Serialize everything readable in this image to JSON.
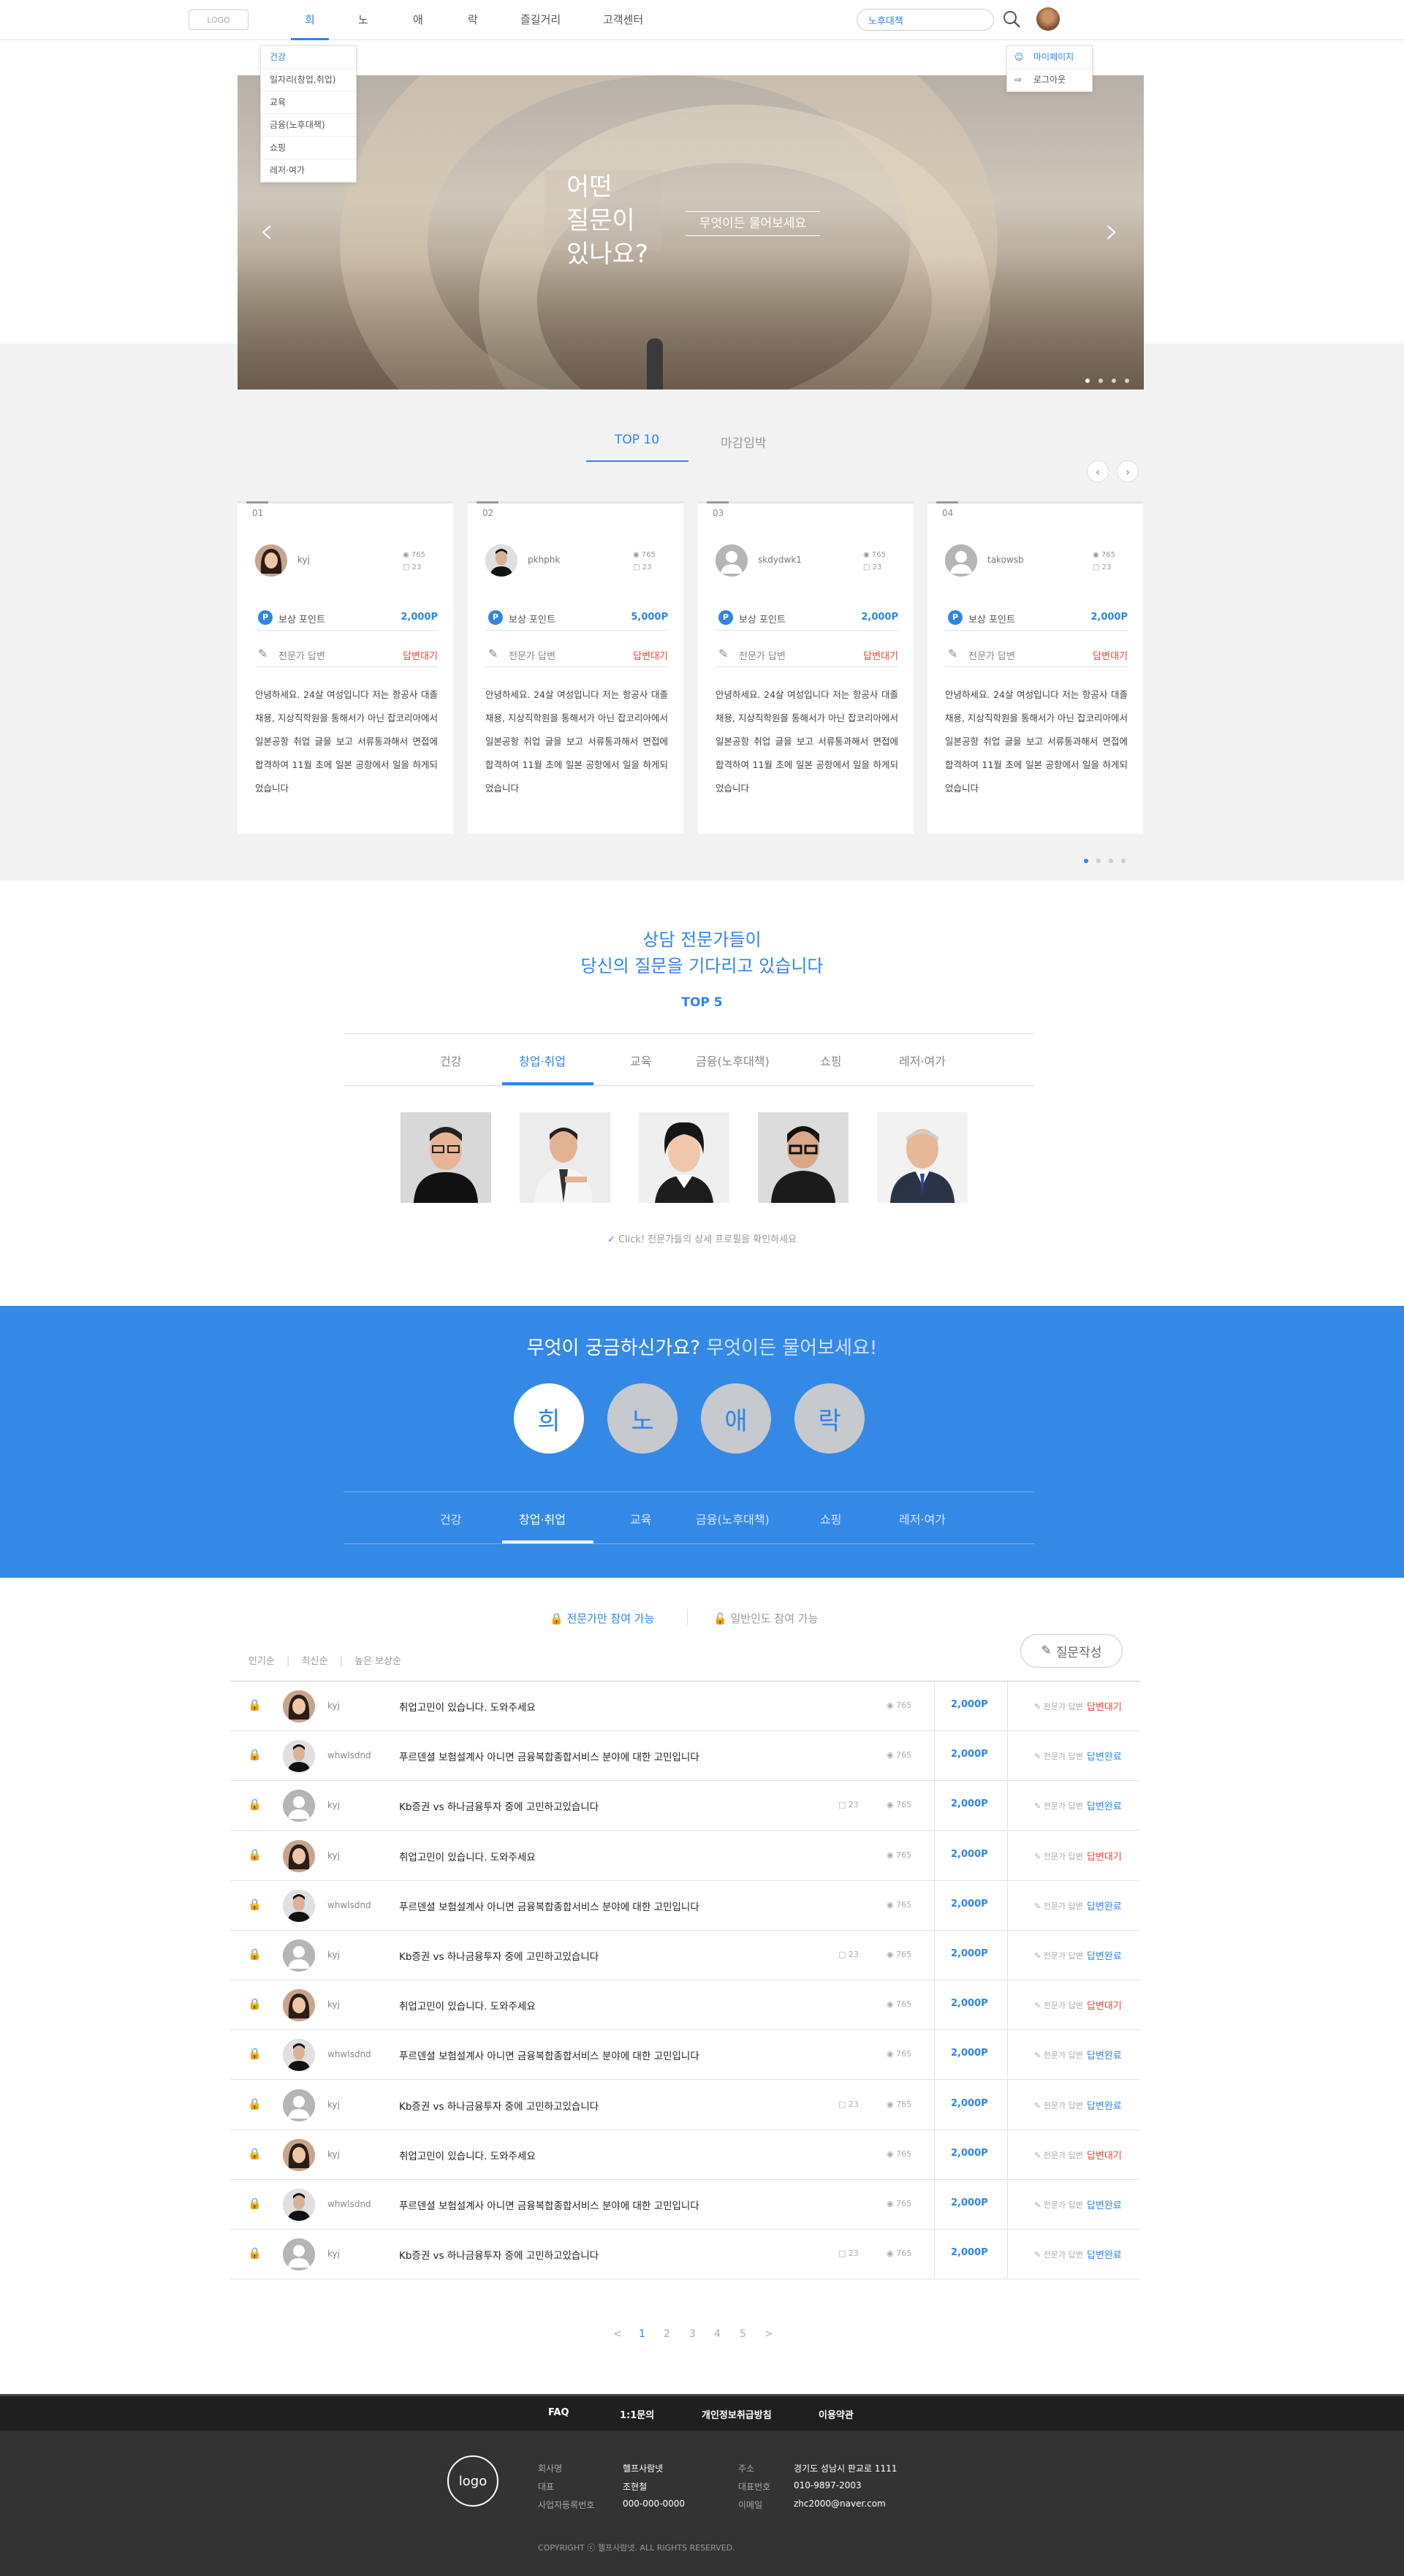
{
  "header": {
    "logo": "LOGO",
    "nav": [
      "희",
      "노",
      "애",
      "락",
      "즐길거리",
      "고객센터"
    ],
    "search_value": "노후대책"
  },
  "category_dropdown": [
    "건강",
    "일자리(창업,취업)",
    "교육",
    "금융(노후대책)",
    "쇼핑",
    "레저·여가"
  ],
  "user_menu": [
    "마이페이지",
    "로그아웃"
  ],
  "hero": {
    "title": "어떤\n질문이\n있나요?",
    "ask": "무엇이든 물어보세요"
  },
  "top_tabs": [
    "TOP 10",
    "마감임박"
  ],
  "cards": [
    {
      "num": "01",
      "name": "kyj",
      "views": "765",
      "comments": "23",
      "point_label": "보상 포인트",
      "point": "2,000P",
      "answer_label": "전문가 답변",
      "status": "답변대기",
      "body": "안녕하세요. 24살 여성입니다 저는 항공사 대졸채용, 지상직학원을 통해서가 아닌 잡코리아에서 일본공항 취업 글을 보고 서류통과해서 면접에 합격하여 11월 초에 일본 공항에서 일을 하게되었습니다"
    },
    {
      "num": "02",
      "name": "pkhphk",
      "views": "765",
      "comments": "23",
      "point_label": "보상 포인트",
      "point": "5,000P",
      "answer_label": "전문가 답변",
      "status": "답변대기",
      "body": "안녕하세요. 24살 여성입니다 저는 항공사 대졸채용, 지상직학원을 통해서가 아닌 잡코리아에서 일본공항 취업 글을 보고 서류통과해서 면접에 합격하여 11월 초에 일본 공항에서 일을 하게되었습니다"
    },
    {
      "num": "03",
      "name": "skdydwk1",
      "views": "765",
      "comments": "23",
      "point_label": "보상 포인트",
      "point": "2,000P",
      "answer_label": "전문가 답변",
      "status": "답변대기",
      "body": "안녕하세요. 24살 여성입니다 저는 항공사 대졸채용, 지상직학원을 통해서가 아닌 잡코리아에서 일본공항 취업 글을 보고 서류통과해서 면접에 합격하여 11월 초에 일본 공항에서 일을 하게되었습니다"
    },
    {
      "num": "04",
      "name": "takowsb",
      "views": "765",
      "comments": "23",
      "point_label": "보상 포인트",
      "point": "2,000P",
      "answer_label": "전문가 답변",
      "status": "답변대기",
      "body": "안녕하세요. 24살 여성입니다 저는 항공사 대졸채용, 지상직학원을 통해서가 아닌 잡코리아에서 일본공항 취업 글을 보고 서류통과해서 면접에 합격하여 11월 초에 일본 공항에서 일을 하게되었습니다"
    }
  ],
  "experts": {
    "line1": "상담 전문가들이",
    "line2": "당신의 질문을 기다리고 있습니다",
    "top5": "TOP 5",
    "tabs": [
      "건강",
      "창업·취업",
      "교육",
      "금융(노후대책)",
      "쇼핑",
      "레저·여가"
    ],
    "tip": "Click! 전문가들의 상세 프로필을 확인하세요"
  },
  "ask_banner": {
    "q1": "무엇이 궁금하신가요?",
    "q2": "무엇이든 물어보세요!",
    "circles": [
      "희",
      "노",
      "애",
      "락"
    ],
    "tabs": [
      "건강",
      "창업·취업",
      "교육",
      "금융(노후대책)",
      "쇼핑",
      "레저·여가"
    ]
  },
  "list": {
    "filter1": "전문가만 참여 가능",
    "filter2": "일반인도 참여 가능",
    "sort": [
      "인기순",
      "최신순",
      "높은 보상순"
    ],
    "write": "질문작성",
    "answer_label": "전문가 답변",
    "rows": [
      {
        "name": "kyj",
        "title": "취업고민이 있습니다. 도와주세요",
        "comments": "",
        "views": "765",
        "point": "2,000P",
        "status": "답변대기",
        "av": "f"
      },
      {
        "name": "whwlsdnd",
        "title": "푸르덴셜 보험설계사 아니면 금융복합종합서비스 분야에 대한 고민입니다",
        "comments": "",
        "views": "765",
        "point": "2,000P",
        "status": "답변완료",
        "av": "m"
      },
      {
        "name": "kyj",
        "title": "Kb증권 vs 하나금융투자 중에 고민하고있습니다",
        "comments": "23",
        "views": "765",
        "point": "2,000P",
        "status": "답변완료",
        "av": "g"
      },
      {
        "name": "kyj",
        "title": "취업고민이 있습니다. 도와주세요",
        "comments": "",
        "views": "765",
        "point": "2,000P",
        "status": "답변대기",
        "av": "f"
      },
      {
        "name": "whwlsdnd",
        "title": "푸르덴셜 보험설계사 아니면 금융복합종합서비스 분야에 대한 고민입니다",
        "comments": "",
        "views": "765",
        "point": "2,000P",
        "status": "답변완료",
        "av": "m"
      },
      {
        "name": "kyj",
        "title": "Kb증권 vs 하나금융투자 중에 고민하고있습니다",
        "comments": "23",
        "views": "765",
        "point": "2,000P",
        "status": "답변완료",
        "av": "g"
      },
      {
        "name": "kyj",
        "title": "취업고민이 있습니다. 도와주세요",
        "comments": "",
        "views": "765",
        "point": "2,000P",
        "status": "답변대기",
        "av": "f"
      },
      {
        "name": "whwlsdnd",
        "title": "푸르덴셜 보험설계사 아니면 금융복합종합서비스 분야에 대한 고민입니다",
        "comments": "",
        "views": "765",
        "point": "2,000P",
        "status": "답변완료",
        "av": "m"
      },
      {
        "name": "kyj",
        "title": "Kb증권 vs 하나금융투자 중에 고민하고있습니다",
        "comments": "23",
        "views": "765",
        "point": "2,000P",
        "status": "답변완료",
        "av": "g"
      },
      {
        "name": "kyj",
        "title": "취업고민이 있습니다. 도와주세요",
        "comments": "",
        "views": "765",
        "point": "2,000P",
        "status": "답변대기",
        "av": "f"
      },
      {
        "name": "whwlsdnd",
        "title": "푸르덴셜 보험설계사 아니면 금융복합종합서비스 분야에 대한 고민입니다",
        "comments": "",
        "views": "765",
        "point": "2,000P",
        "status": "답변완료",
        "av": "m"
      },
      {
        "name": "kyj",
        "title": "Kb증권 vs 하나금융투자 중에 고민하고있습니다",
        "comments": "23",
        "views": "765",
        "point": "2,000P",
        "status": "답변완료",
        "av": "g"
      }
    ]
  },
  "pager": [
    "<",
    "1",
    "2",
    "3",
    "4",
    "5",
    ">"
  ],
  "footer": {
    "links": [
      "FAQ",
      "1:1문의",
      "개인정보취급방침",
      "이용약관"
    ],
    "logo": "logo",
    "info_left": [
      [
        "회사명",
        "헬프사람넷"
      ],
      [
        "대표",
        "조현철"
      ],
      [
        "사업자등록번호",
        "000-000-0000"
      ]
    ],
    "info_right": [
      [
        "주소",
        "경기도 성남시 판교로 1111"
      ],
      [
        "대표번호",
        "010-9897-2003"
      ],
      [
        "이메일",
        "zhc2000@naver.com"
      ]
    ],
    "copyright": "COPYRIGHT ⓒ 헬프사람넷. ALL RIGHTS RESERVED."
  },
  "colors": {
    "accent": "#2f85e5",
    "banner": "#3589e6",
    "waiting": "#e0463a",
    "footer": "#333333"
  }
}
